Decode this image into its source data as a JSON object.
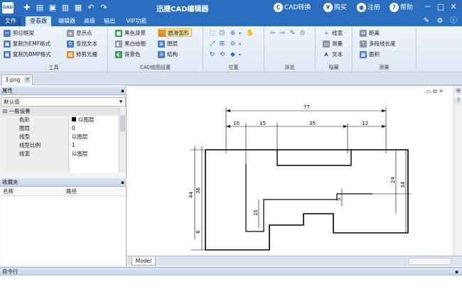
{
  "titlebar": {
    "app_icon": "GAD",
    "title": "迅捷CAD编辑器",
    "convert": "CAD转换",
    "buy": "购买",
    "register": "注册",
    "help": "帮助"
  },
  "menu": {
    "file": "文件",
    "tabs": [
      "查看器",
      "编辑器",
      "高级",
      "输出",
      "VIP功能"
    ],
    "active_tab": "查看器"
  },
  "ribbon": {
    "tools": {
      "label": "工具",
      "items": [
        "剪切框架",
        "复制为EMF格式",
        "复制为BMP格式",
        "显示点",
        "查找文本",
        "修剪光栅"
      ]
    },
    "display": {
      "label": "CAD绘图设置",
      "items": [
        "黑色背景",
        "黑白绘图",
        "背景色",
        "圆滑弧形",
        "图层",
        "结构"
      ]
    },
    "position": {
      "label": "位置"
    },
    "browse": {
      "label": "浏览"
    },
    "hide": {
      "label": "隐藏",
      "items": [
        "线宽",
        "测量",
        "文本"
      ]
    },
    "measure": {
      "label": "测量",
      "items": [
        "距离",
        "多段线长度",
        "面积"
      ]
    }
  },
  "document_tab": "3.png",
  "properties": {
    "title": "属性",
    "combo_value": "默认值",
    "group": "一般设置",
    "rows": [
      {
        "name": "色彩",
        "value": "以图层"
      },
      {
        "name": "图层",
        "value": "0"
      },
      {
        "name": "线型",
        "value": "以图层"
      },
      {
        "name": "线型比例",
        "value": "1"
      },
      {
        "name": "线宽",
        "value": "以图层"
      }
    ]
  },
  "favorites": {
    "title": "收藏夹",
    "col_name": "名称",
    "col_path": "路径"
  },
  "drawing": {
    "dims": [
      "77",
      "10",
      "15",
      "35",
      "12",
      "44",
      "36",
      "6",
      "15",
      "5",
      "24",
      "34"
    ]
  },
  "model_tab": "Model",
  "command_line": "命令行"
}
